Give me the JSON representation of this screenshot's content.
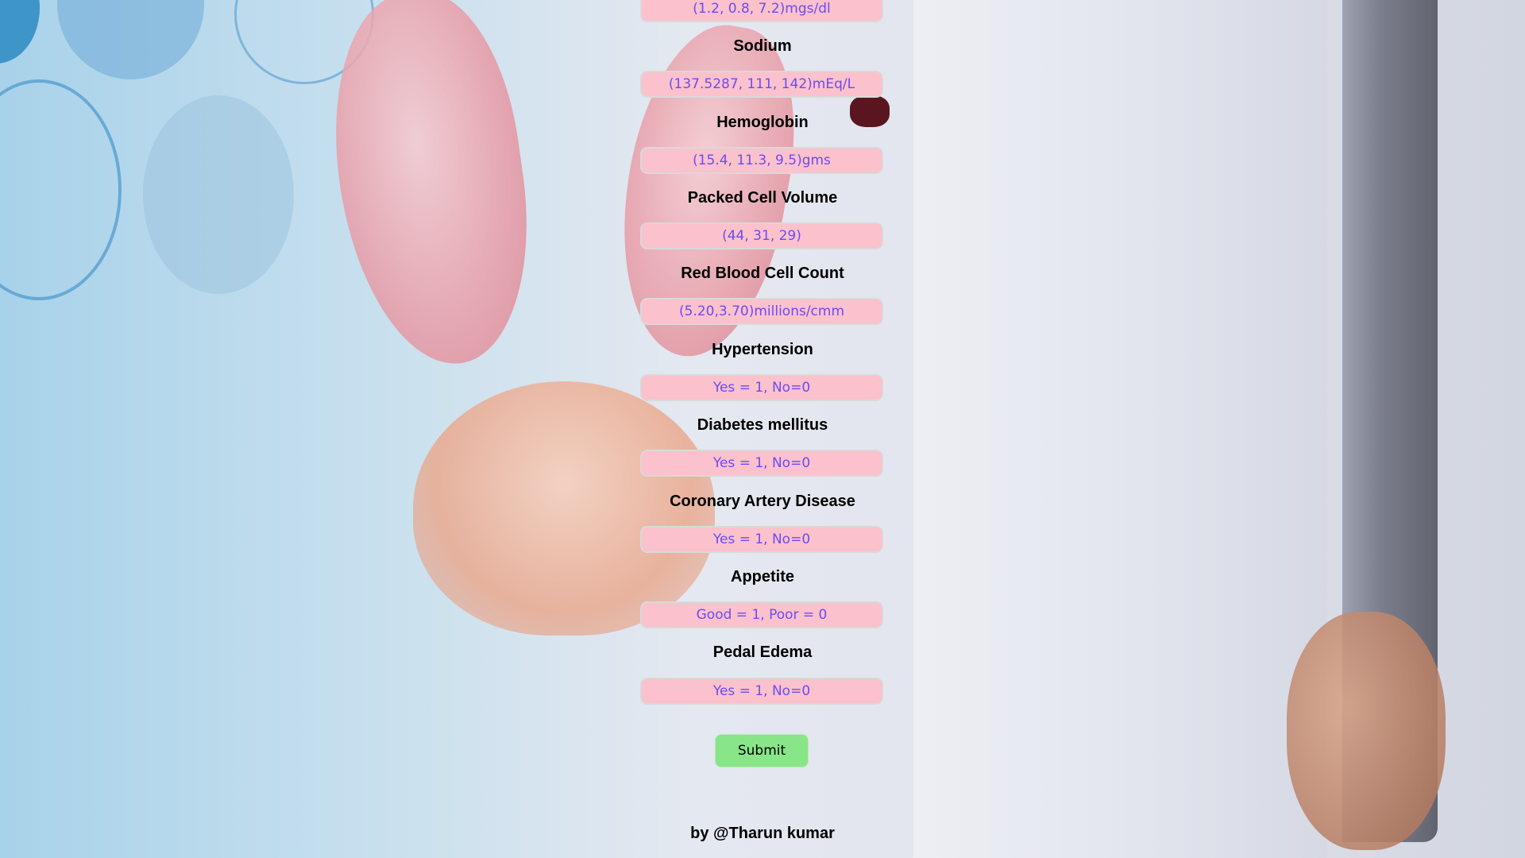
{
  "fields": [
    {
      "label": "",
      "placeholder": "(1.2, 0.8, 7.2)mgs/dl"
    },
    {
      "label": "Sodium",
      "placeholder": "(137.5287, 111, 142)mEq/L"
    },
    {
      "label": "Hemoglobin",
      "placeholder": "(15.4, 11.3, 9.5)gms"
    },
    {
      "label": "Packed Cell Volume",
      "placeholder": "(44, 31, 29)"
    },
    {
      "label": "Red Blood Cell Count",
      "placeholder": "(5.20,3.70)millions/cmm"
    },
    {
      "label": "Hypertension",
      "placeholder": "Yes = 1, No=0"
    },
    {
      "label": "Diabetes mellitus",
      "placeholder": "Yes = 1, No=0"
    },
    {
      "label": "Coronary Artery Disease",
      "placeholder": "Yes = 1, No=0"
    },
    {
      "label": "Appetite",
      "placeholder": "Good = 1, Poor = 0"
    },
    {
      "label": "Pedal Edema",
      "placeholder": "Yes = 1, No=0"
    }
  ],
  "submit_label": "Submit",
  "credit": "by @Tharun kumar",
  "colors": {
    "input_bg": "#fbc1cc",
    "input_text": "#5a3ff0",
    "button_bg": "#88e588"
  }
}
